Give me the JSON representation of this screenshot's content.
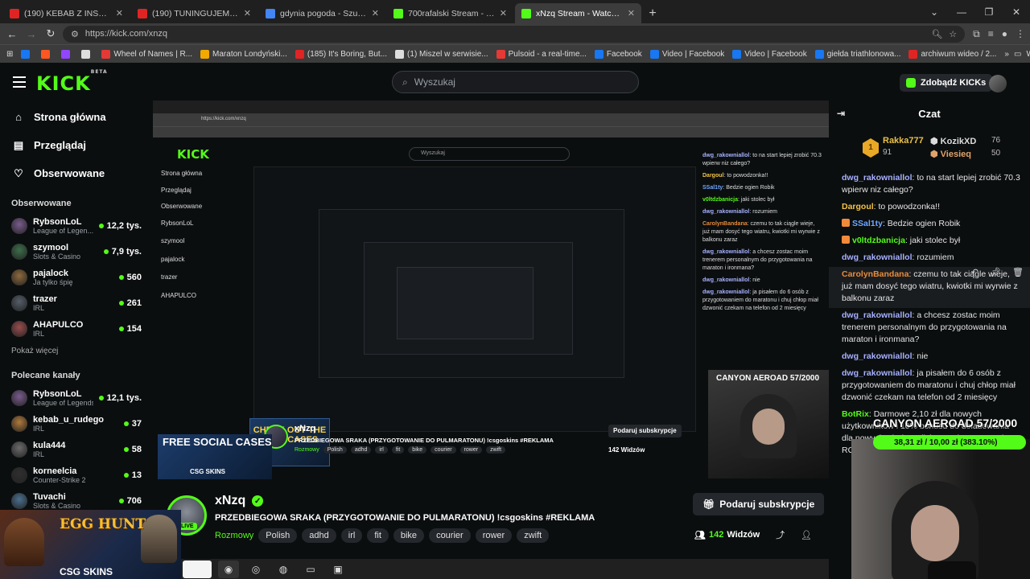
{
  "browser": {
    "tabs": [
      {
        "title": "(190) KEBAB Z INSTAGRAMA W",
        "color": "#e02424"
      },
      {
        "title": "(190) TUNINGUJEMY NASZEGO",
        "color": "#e02424"
      },
      {
        "title": "gdynia pogoda - Szukaj w Goo",
        "color": "#4285f4"
      },
      {
        "title": "700rafalski Stream - Watch Live",
        "color": "#53fc18"
      },
      {
        "title": "xNzq Stream - Watch Live on K",
        "color": "#53fc18",
        "active": true
      }
    ],
    "url": "https://kick.com/xnzq",
    "bookmarks": [
      {
        "label": "",
        "color": "#1877f2"
      },
      {
        "label": "",
        "color": "#ff5722"
      },
      {
        "label": "",
        "color": "#9146ff"
      },
      {
        "label": "",
        "color": "#dddddd"
      },
      {
        "label": "Wheel of Names | R...",
        "color": "#e53935"
      },
      {
        "label": "Maraton Londyński...",
        "color": "#f2a900"
      },
      {
        "label": "(185) It's Boring, But...",
        "color": "#e02424"
      },
      {
        "label": "(1) Miszel w serwisie...",
        "color": "#dddddd"
      },
      {
        "label": "Pulsoid - a real-time...",
        "color": "#e53935"
      },
      {
        "label": "Facebook",
        "color": "#1877f2"
      },
      {
        "label": "Video | Facebook",
        "color": "#1877f2"
      },
      {
        "label": "Video | Facebook",
        "color": "#1877f2"
      },
      {
        "label": "giełda triathlonowa...",
        "color": "#1877f2"
      },
      {
        "label": "archiwum wideo / 2...",
        "color": "#e02424"
      }
    ],
    "bookmarks_all": "Wszystkie zakładki"
  },
  "header": {
    "logo": "KICK",
    "logo_beta": "BETA",
    "search_placeholder": "Wyszukaj",
    "get_kicks": "Zdobądź KICKs"
  },
  "sidebar": {
    "nav": [
      {
        "label": "Strona główna",
        "icon": "home-icon"
      },
      {
        "label": "Przeglądaj",
        "icon": "browse-icon"
      },
      {
        "label": "Obserwowane",
        "icon": "heart-icon"
      }
    ],
    "followed_title": "Obserwowane",
    "followed": [
      {
        "name": "RybsonLoL",
        "category": "League of Legen...",
        "viewers": "12,2 tys.",
        "color": "#7a5c8e"
      },
      {
        "name": "szymool",
        "category": "Slots & Casino",
        "viewers": "7,9 tys.",
        "color": "#3d6e4a"
      },
      {
        "name": "pajalock",
        "category": "Ja tylko śpię",
        "viewers": "560",
        "color": "#8e6a3d"
      },
      {
        "name": "trazer",
        "category": "IRL",
        "viewers": "261",
        "color": "#555e6a"
      },
      {
        "name": "AHAPULCO",
        "category": "IRL",
        "viewers": "154",
        "color": "#9a4d4d"
      }
    ],
    "show_more": "Pokaż więcej",
    "recommended_title": "Polecane kanały",
    "recommended": [
      {
        "name": "RybsonLoL",
        "category": "League of Legends",
        "viewers": "12,1 tys.",
        "color": "#7a5c8e"
      },
      {
        "name": "kebab_u_rudego",
        "category": "IRL",
        "viewers": "37",
        "color": "#b07a3a"
      },
      {
        "name": "kula444",
        "category": "IRL",
        "viewers": "58",
        "color": "#6b6b6b"
      },
      {
        "name": "korneelcia",
        "category": "Counter-Strike 2",
        "viewers": "13",
        "color": "#2f2f2f"
      },
      {
        "name": "Tuvachi",
        "category": "Slots & Casino",
        "viewers": "706",
        "color": "#4a6f8e"
      }
    ]
  },
  "player_overlay": {
    "canyon": "CANYON AEROAD 57/2000",
    "progress": "38,31 zł / 10,00 zł (383.10%)",
    "progress_value_pct": 383.1,
    "check_out": "CHECK OUT THE BEST CASES",
    "free_cases": "FREE SOCIAL CASES",
    "csg_skins": "CSG SKINS",
    "egg_hunt": "EGG HUNT"
  },
  "stream": {
    "name": "xNzq",
    "title": "PRZEDBIEGOWA SRAKA (PRZYGOTOWANIE DO PULMARATONU) !csgoskins #REKLAMA",
    "category": "Rozmowy",
    "tags": [
      "Polish",
      "adhd",
      "irl",
      "fit",
      "bike",
      "courier",
      "rower",
      "zwift"
    ],
    "subscribe": "Podaruj subskrypcje",
    "viewers": "142",
    "viewers_label": "Widzów",
    "live": "LIVE"
  },
  "chat": {
    "title": "Czat",
    "leaderboard": [
      {
        "name": "Rakka777",
        "score": "91"
      },
      {
        "name": "KozikXD",
        "score": "76"
      },
      {
        "name": "Viesieq",
        "score": "50"
      }
    ],
    "messages": [
      {
        "user": "dwg_rakowniallol",
        "color": "#a7b0ff",
        "text": "to na start lepiej zrobić 70.3 wpierw niz całego?"
      },
      {
        "user": "Dargoul",
        "color": "#f3c343",
        "text": "to powodzonka!!"
      },
      {
        "user": "SSal1ty",
        "color": "#6ea8ff",
        "text": "Bedzie ogien Robik",
        "badge": "#f28a3a"
      },
      {
        "user": "v0ltdzbanicja",
        "color": "#53fc18",
        "text": "jaki stolec był",
        "badge": "#f28a3a"
      },
      {
        "user": "dwg_rakowniallol",
        "color": "#a7b0ff",
        "text": "rozumiem"
      },
      {
        "user": "CarolynBandana",
        "color": "#e88b3a",
        "text": "czemu to tak ciągle wieje, już mam dosyć tego wiatru, kwiotki mi wyrwie z balkonu zaraz",
        "highlight": true
      },
      {
        "user": "dwg_rakowniallol",
        "color": "#a7b0ff",
        "text": "a chcesz zostac moim trenerem personalnym do przygotowania na maraton i ironmana?"
      },
      {
        "user": "dwg_rakowniallol",
        "color": "#a7b0ff",
        "text": "nie"
      },
      {
        "user": "dwg_rakowniallol",
        "color": "#a7b0ff",
        "text": "ja pisałem do 6 osób z przygotowaniem do maratonu i chuj chłop miał dzwonić czekam na telefon od 2 miesięcy"
      },
      {
        "user": "BotRix",
        "color": "#53fc18",
        "text": "Darmowe 2,10 zł dla nowych użytkowników i 10% bonusu do doładowania dla nowych użytkowników zarejestrowanych w ROBO"
      }
    ]
  },
  "taskbar": {
    "items": [
      "blank",
      "chrome-icon",
      "discord-icon",
      "obs-icon",
      "terminal-icon",
      "app-icon"
    ]
  }
}
